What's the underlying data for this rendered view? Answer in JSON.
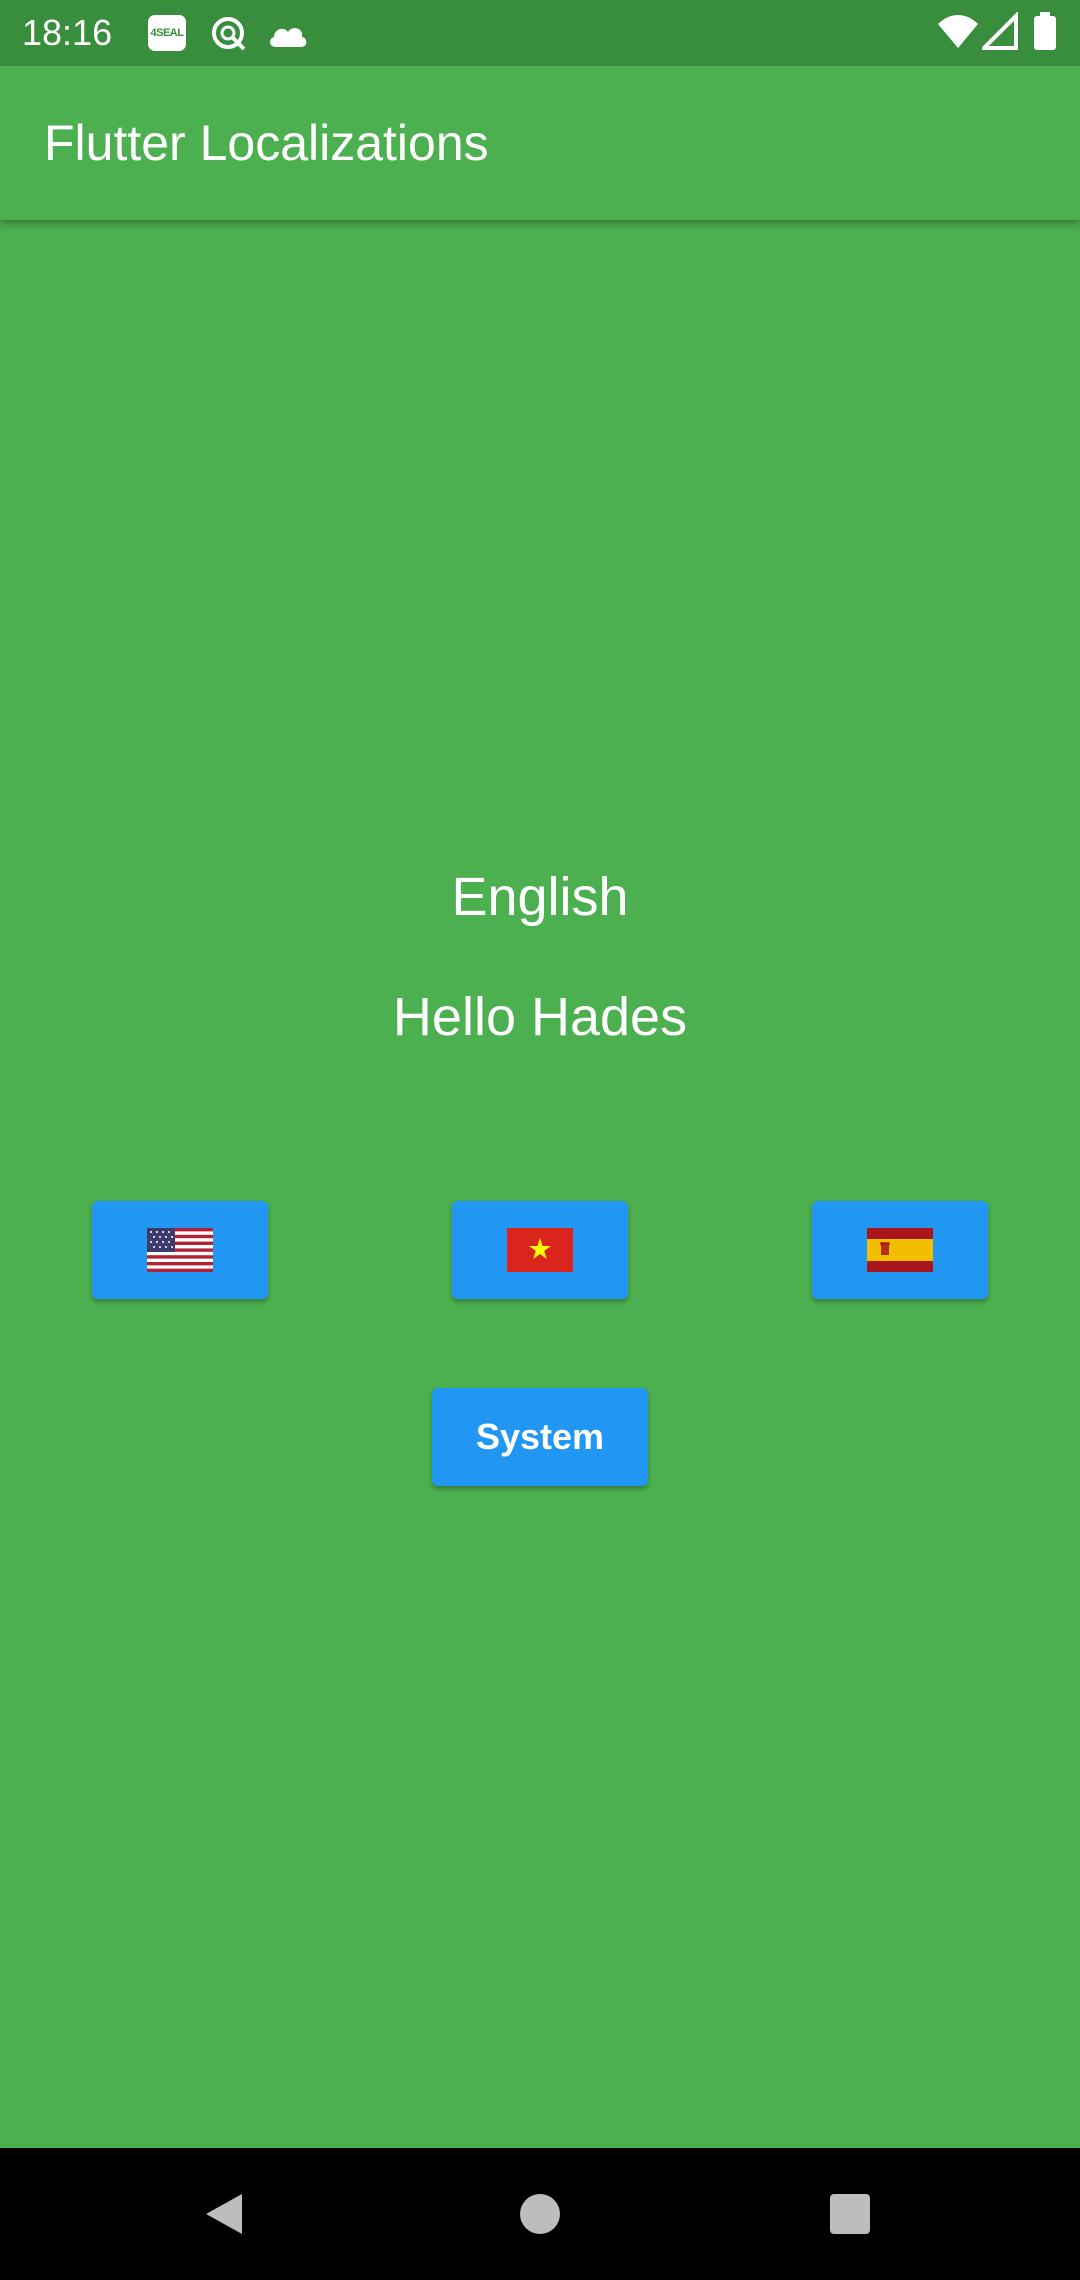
{
  "status_bar": {
    "time": "18:16",
    "seal_text": "4SEAL",
    "icons": [
      "seal-app-icon",
      "sync-icon",
      "cloud-icon",
      "wifi-icon",
      "signal-icon",
      "battery-icon"
    ],
    "background": "#388E3C"
  },
  "app_bar": {
    "title": "Flutter Localizations",
    "background": "#4CAF50"
  },
  "content": {
    "language_name": "English",
    "greeting": "Hello Hades"
  },
  "language_buttons": [
    {
      "locale_icon": "us-flag-icon"
    },
    {
      "locale_icon": "vietnam-flag-icon"
    },
    {
      "locale_icon": "spain-flag-icon"
    }
  ],
  "system_button": {
    "label": "System"
  },
  "nav_bar": {
    "icons": [
      "back-icon",
      "home-icon",
      "recent-apps-icon"
    ]
  },
  "colors": {
    "background": "#4CAF50",
    "button": "#2196F3",
    "status_bar": "#388E3C"
  }
}
